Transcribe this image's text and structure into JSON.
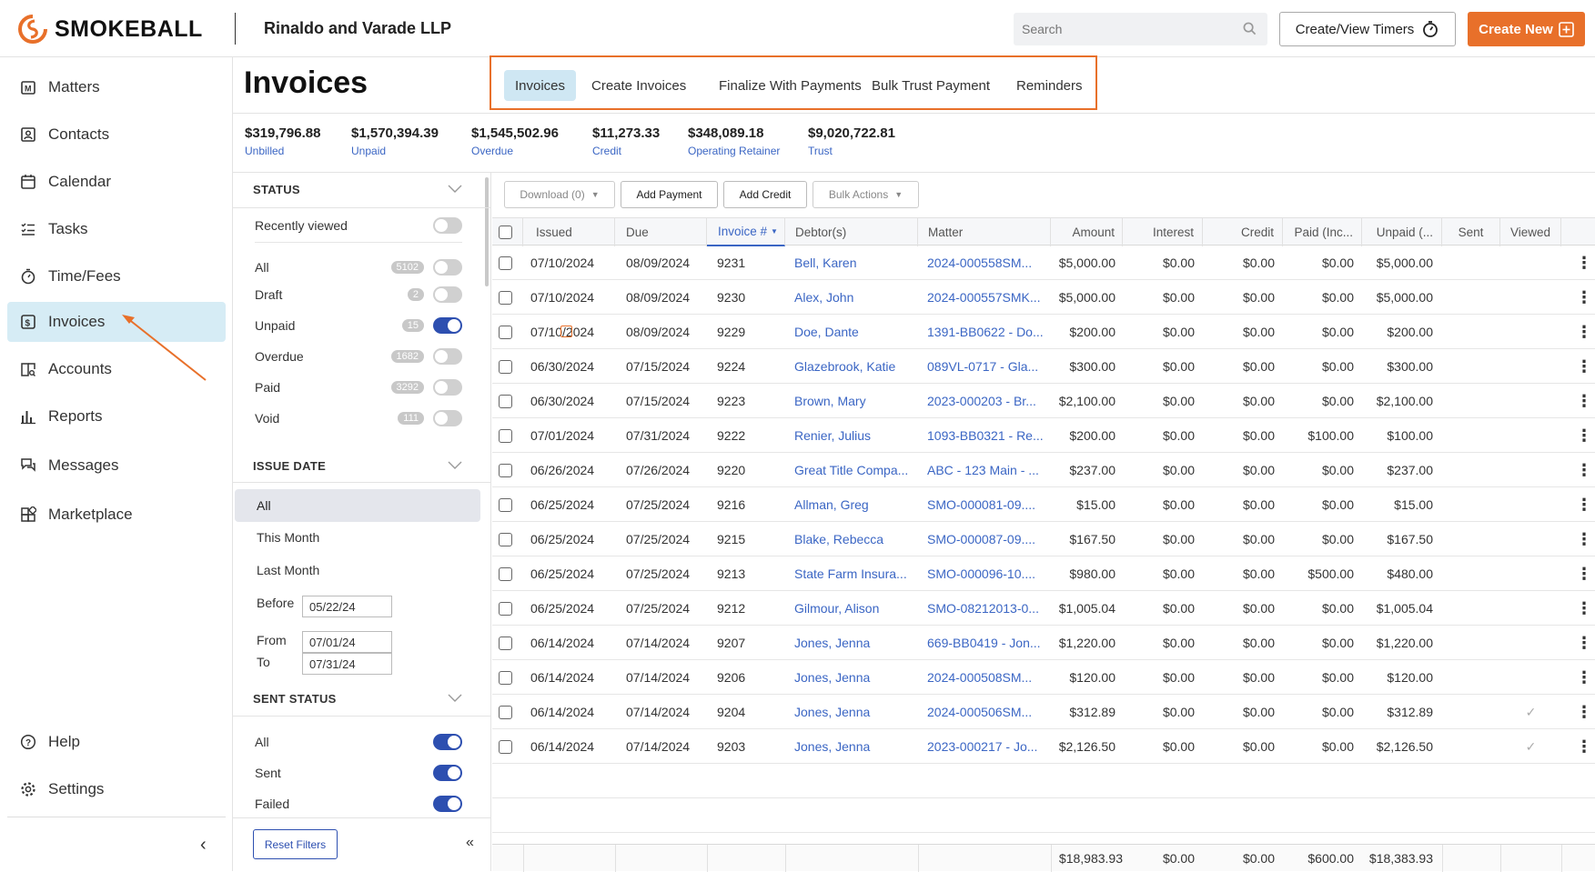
{
  "header": {
    "brand": "SMOKEBALL",
    "firm": "Rinaldo and Varade LLP",
    "search_placeholder": "Search",
    "timer_label": "Create/View Timers",
    "new_label": "Create New"
  },
  "sidebar": {
    "items": [
      {
        "label": "Matters",
        "icon": "matters-icon"
      },
      {
        "label": "Contacts",
        "icon": "contacts-icon"
      },
      {
        "label": "Calendar",
        "icon": "calendar-icon"
      },
      {
        "label": "Tasks",
        "icon": "tasks-icon"
      },
      {
        "label": "Time/Fees",
        "icon": "stopwatch-icon"
      },
      {
        "label": "Invoices",
        "icon": "invoice-icon"
      },
      {
        "label": "Accounts",
        "icon": "accounts-icon"
      },
      {
        "label": "Reports",
        "icon": "reports-icon"
      },
      {
        "label": "Messages",
        "icon": "messages-icon"
      },
      {
        "label": "Marketplace",
        "icon": "marketplace-icon"
      }
    ],
    "help": "Help",
    "settings": "Settings"
  },
  "page": {
    "title": "Invoices",
    "tabs": [
      "Invoices",
      "Create Invoices",
      "Finalize With Payments",
      "Bulk Trust Payment",
      "Reminders"
    ]
  },
  "stats": [
    {
      "value": "$319,796.88",
      "label": "Unbilled"
    },
    {
      "value": "$1,570,394.39",
      "label": "Unpaid"
    },
    {
      "value": "$1,545,502.96",
      "label": "Overdue"
    },
    {
      "value": "$11,273.33",
      "label": "Credit"
    },
    {
      "value": "$348,089.18",
      "label": "Operating Retainer"
    },
    {
      "value": "$9,020,722.81",
      "label": "Trust"
    }
  ],
  "filters": {
    "status_heading": "STATUS",
    "recently_viewed": "Recently viewed",
    "status": [
      {
        "label": "All",
        "count": "5102",
        "on": false
      },
      {
        "label": "Draft",
        "count": "2",
        "on": false
      },
      {
        "label": "Unpaid",
        "count": "15",
        "on": true
      },
      {
        "label": "Overdue",
        "count": "1682",
        "on": false
      },
      {
        "label": "Paid",
        "count": "3292",
        "on": false
      },
      {
        "label": "Void",
        "count": "111",
        "on": false
      }
    ],
    "issue_heading": "ISSUE DATE",
    "issue_all": "All",
    "this_month": "This Month",
    "last_month": "Last Month",
    "before_label": "Before",
    "before_value": "05/22/24",
    "from_label": "From",
    "from_value": "07/01/24",
    "to_label": "To",
    "to_value": "07/31/24",
    "sent_heading": "SENT STATUS",
    "sent": [
      {
        "label": "All",
        "on": true
      },
      {
        "label": "Sent",
        "on": true
      },
      {
        "label": "Failed",
        "on": true
      }
    ],
    "reset": "Reset Filters"
  },
  "toolbar": {
    "download": "Download (0)",
    "add_payment": "Add Payment",
    "add_credit": "Add Credit",
    "bulk_actions": "Bulk Actions"
  },
  "table": {
    "columns": [
      "Issued",
      "Due",
      "Invoice #",
      "Debtor(s)",
      "Matter",
      "Amount",
      "Interest",
      "Credit",
      "Paid (Inc...",
      "Unpaid (...",
      "Sent",
      "Viewed"
    ],
    "rows": [
      {
        "issued": "07/10/2024",
        "due": "08/09/2024",
        "inv": "9231",
        "debtor": "Bell, Karen",
        "matter": "2024-000558SM...",
        "amount": "$5,000.00",
        "interest": "$0.00",
        "credit": "$0.00",
        "paid": "$0.00",
        "unpaid": "$5,000.00",
        "viewed": ""
      },
      {
        "issued": "07/10/2024",
        "due": "08/09/2024",
        "inv": "9230",
        "debtor": "Alex, John",
        "matter": "2024-000557SMK...",
        "amount": "$5,000.00",
        "interest": "$0.00",
        "credit": "$0.00",
        "paid": "$0.00",
        "unpaid": "$5,000.00",
        "viewed": ""
      },
      {
        "issued": "07/10/2024",
        "due": "08/09/2024",
        "inv": "9229",
        "debtor": "Doe, Dante",
        "matter": "1391-BB0622 - Do...",
        "amount": "$200.00",
        "interest": "$0.00",
        "credit": "$0.00",
        "paid": "$0.00",
        "unpaid": "$200.00",
        "viewed": ""
      },
      {
        "issued": "06/30/2024",
        "due": "07/15/2024",
        "inv": "9224",
        "debtor": "Glazebrook, Katie",
        "matter": "089VL-0717 - Gla...",
        "amount": "$300.00",
        "interest": "$0.00",
        "credit": "$0.00",
        "paid": "$0.00",
        "unpaid": "$300.00",
        "viewed": ""
      },
      {
        "issued": "06/30/2024",
        "due": "07/15/2024",
        "inv": "9223",
        "debtor": "Brown, Mary",
        "matter": "2023-000203 - Br...",
        "amount": "$2,100.00",
        "interest": "$0.00",
        "credit": "$0.00",
        "paid": "$0.00",
        "unpaid": "$2,100.00",
        "viewed": ""
      },
      {
        "issued": "07/01/2024",
        "due": "07/31/2024",
        "inv": "9222",
        "debtor": "Renier, Julius",
        "matter": "1093-BB0321 - Re...",
        "amount": "$200.00",
        "interest": "$0.00",
        "credit": "$0.00",
        "paid": "$100.00",
        "unpaid": "$100.00",
        "viewed": ""
      },
      {
        "issued": "06/26/2024",
        "due": "07/26/2024",
        "inv": "9220",
        "debtor": "Great Title Compa...",
        "matter": "ABC - 123 Main - ...",
        "amount": "$237.00",
        "interest": "$0.00",
        "credit": "$0.00",
        "paid": "$0.00",
        "unpaid": "$237.00",
        "viewed": ""
      },
      {
        "issued": "06/25/2024",
        "due": "07/25/2024",
        "inv": "9216",
        "debtor": "Allman, Greg",
        "matter": "SMO-000081-09....",
        "amount": "$15.00",
        "interest": "$0.00",
        "credit": "$0.00",
        "paid": "$0.00",
        "unpaid": "$15.00",
        "viewed": ""
      },
      {
        "issued": "06/25/2024",
        "due": "07/25/2024",
        "inv": "9215",
        "debtor": "Blake, Rebecca",
        "matter": "SMO-000087-09....",
        "amount": "$167.50",
        "interest": "$0.00",
        "credit": "$0.00",
        "paid": "$0.00",
        "unpaid": "$167.50",
        "viewed": ""
      },
      {
        "issued": "06/25/2024",
        "due": "07/25/2024",
        "inv": "9213",
        "debtor": "State Farm Insura...",
        "matter": "SMO-000096-10....",
        "amount": "$980.00",
        "interest": "$0.00",
        "credit": "$0.00",
        "paid": "$500.00",
        "unpaid": "$480.00",
        "viewed": ""
      },
      {
        "issued": "06/25/2024",
        "due": "07/25/2024",
        "inv": "9212",
        "debtor": "Gilmour, Alison",
        "matter": "SMO-08212013-0...",
        "amount": "$1,005.04",
        "interest": "$0.00",
        "credit": "$0.00",
        "paid": "$0.00",
        "unpaid": "$1,005.04",
        "viewed": ""
      },
      {
        "issued": "06/14/2024",
        "due": "07/14/2024",
        "inv": "9207",
        "debtor": "Jones, Jenna",
        "matter": "669-BB0419 - Jon...",
        "amount": "$1,220.00",
        "interest": "$0.00",
        "credit": "$0.00",
        "paid": "$0.00",
        "unpaid": "$1,220.00",
        "viewed": ""
      },
      {
        "issued": "06/14/2024",
        "due": "07/14/2024",
        "inv": "9206",
        "debtor": "Jones, Jenna",
        "matter": "2024-000508SM...",
        "amount": "$120.00",
        "interest": "$0.00",
        "credit": "$0.00",
        "paid": "$0.00",
        "unpaid": "$120.00",
        "viewed": ""
      },
      {
        "issued": "06/14/2024",
        "due": "07/14/2024",
        "inv": "9204",
        "debtor": "Jones, Jenna",
        "matter": "2024-000506SM...",
        "amount": "$312.89",
        "interest": "$0.00",
        "credit": "$0.00",
        "paid": "$0.00",
        "unpaid": "$312.89",
        "viewed": "✓"
      },
      {
        "issued": "06/14/2024",
        "due": "07/14/2024",
        "inv": "9203",
        "debtor": "Jones, Jenna",
        "matter": "2023-000217 - Jo...",
        "amount": "$2,126.50",
        "interest": "$0.00",
        "credit": "$0.00",
        "paid": "$0.00",
        "unpaid": "$2,126.50",
        "viewed": "✓"
      }
    ],
    "totals": {
      "amount": "$18,983.93",
      "interest": "$0.00",
      "credit": "$0.00",
      "paid": "$600.00",
      "unpaid": "$18,383.93"
    }
  },
  "colors": {
    "accent": "#e8702a",
    "link": "#3b66c4",
    "active_nav": "#d6ecf5",
    "toggle_on": "#2d4fb0"
  }
}
